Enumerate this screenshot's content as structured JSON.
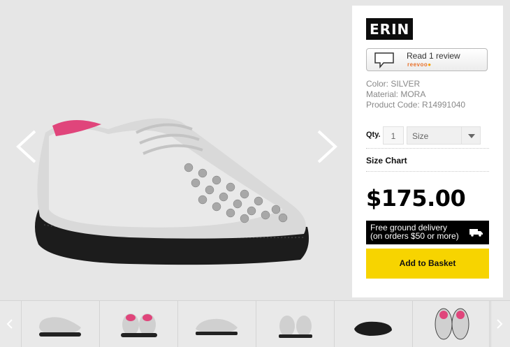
{
  "product": {
    "brand_name": "ERIN",
    "review": {
      "text": "Read 1 review",
      "logo": "reevoo"
    },
    "specs": {
      "color": "Color: SILVER",
      "material": "Material: MORA",
      "code": "Product Code: R14991040"
    },
    "qty": {
      "label": "Qty.",
      "value": "1"
    },
    "size": {
      "placeholder": "Size"
    },
    "size_chart": "Size Chart",
    "price": "$175.00",
    "delivery": {
      "line1": "Free ground delivery",
      "line2": "(on orders $50 or more)"
    },
    "basket_button": "Add to Basket"
  },
  "colors": {
    "accent_yellow": "#f7d400",
    "brand_black": "#0d0d0d",
    "reevoo_orange": "#e8702a"
  },
  "icons": {
    "gallery_prev": "chevron-left-icon",
    "gallery_next": "chevron-right-icon",
    "review": "speech-bubble-icon",
    "delivery": "truck-icon",
    "size_dropdown": "caret-down-icon"
  },
  "thumbnails": [
    {
      "name": "side-view"
    },
    {
      "name": "rear-view"
    },
    {
      "name": "inner-side-view"
    },
    {
      "name": "front-view"
    },
    {
      "name": "sole-view"
    },
    {
      "name": "top-view"
    }
  ]
}
